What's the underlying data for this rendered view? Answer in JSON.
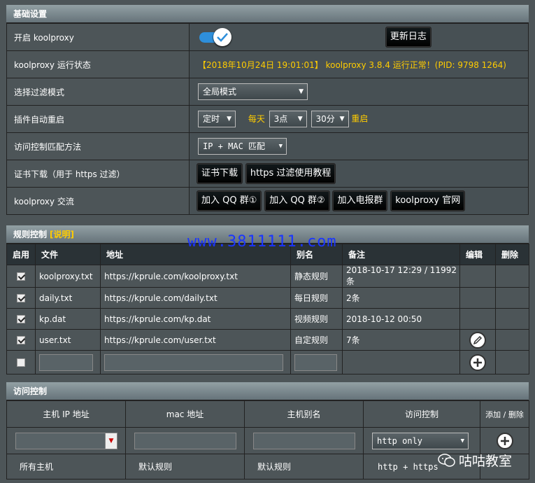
{
  "basic": {
    "title": "基础设置",
    "rows": {
      "enable_label": "开启 koolproxy",
      "changelog_btn": "更新日志",
      "status_label": "koolproxy 运行状态",
      "status_text": "【2018年10月24日 19:01:01】 koolproxy 3.8.4 运行正常！(PID: 9798 1264)",
      "filter_label": "选择过滤模式",
      "filter_value": "全局模式",
      "restart_label": "插件自动重启",
      "restart_mode": "定时",
      "restart_every": "每天",
      "restart_hour": "3点",
      "restart_min": "30分",
      "restart_suffix": "重启",
      "acl_label": "访问控制匹配方法",
      "acl_value": "IP + MAC 匹配",
      "cert_label": "证书下载（用于 https 过滤）",
      "cert_btn": "证书下载",
      "https_btn": "https 过滤使用教程",
      "comm_label": "koolproxy 交流",
      "qq1_btn": "加入 QQ 群①",
      "qq2_btn": "加入 QQ 群②",
      "tg_btn": "加入电报群",
      "site_btn": "koolproxy 官网"
    },
    "toggle_on": true
  },
  "rules": {
    "title": "规则控制",
    "help_link": "[说明]",
    "headers": [
      "启用",
      "文件",
      "地址",
      "别名",
      "备注",
      "编辑",
      "删除"
    ],
    "rows": [
      {
        "file": "koolproxy.txt",
        "url": "https://kprule.com/koolproxy.txt",
        "alias": "静态规则",
        "note": "2018-10-17 12:29 / 11992条",
        "checked": true
      },
      {
        "file": "daily.txt",
        "url": "https://kprule.com/daily.txt",
        "alias": "每日规则",
        "note": "2条",
        "checked": true
      },
      {
        "file": "kp.dat",
        "url": "https://kprule.com/kp.dat",
        "alias": "视频规则",
        "note": "2018-10-12 00:50",
        "checked": true
      },
      {
        "file": "user.txt",
        "url": "https://kprule.com/user.txt",
        "alias": "自定规则",
        "note": "7条",
        "checked": true
      }
    ]
  },
  "access": {
    "title": "访问控制",
    "headers": [
      "主机 IP 地址",
      "mac 地址",
      "主机别名",
      "访问控制",
      "添加 / 删除"
    ],
    "mode_select": "http only",
    "default_row": [
      "所有主机",
      "默认规则",
      "默认规则",
      "http + https"
    ]
  },
  "watermark": {
    "url": "www.3811111.com",
    "brand": "咕咕教室"
  },
  "colors": {
    "accent": "#ffcc00",
    "toggle": "#2e8fdb",
    "watermark": "#1a35ff"
  }
}
